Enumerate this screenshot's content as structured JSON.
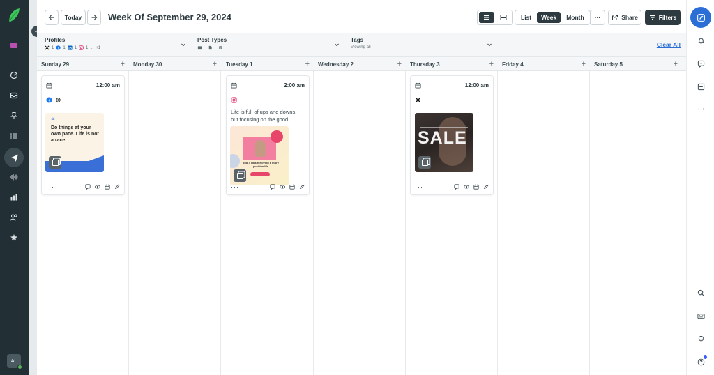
{
  "user": {
    "initials": "AL"
  },
  "header": {
    "today_label": "Today",
    "week_title": "Week Of September 29, 2024",
    "view_list": "List",
    "view_week": "Week",
    "view_month": "Month",
    "more_label": "···",
    "share_label": "Share",
    "filters_label": "Filters"
  },
  "filterbar": {
    "profiles_label": "Profiles",
    "profiles_counts": {
      "x": "1",
      "facebook": "1",
      "linkedin": "1",
      "instagram": "1",
      "extra": "+1"
    },
    "extra_dots": "...",
    "post_types_label": "Post Types",
    "tags_label": "Tags",
    "tags_sub": "Viewing all",
    "clear_all": "Clear All"
  },
  "days": [
    {
      "label": "Sunday 29"
    },
    {
      "label": "Monday 30"
    },
    {
      "label": "Tuesday 1"
    },
    {
      "label": "Wednesday 2"
    },
    {
      "label": "Thursday 3"
    },
    {
      "label": "Friday 4"
    },
    {
      "label": "Saturday 5"
    }
  ],
  "add_symbol": "+",
  "posts": [
    {
      "time": "12:00 am",
      "networks": [
        "facebook",
        "threads"
      ],
      "image_text": "Do things at your own pace. Life is not a race.",
      "quote_mark": "“"
    },
    {
      "time": "2:00 am",
      "networks": [
        "instagram"
      ],
      "caption": "Life is full of ups and downs, but focusing on the good...",
      "image_text": "Top 7 Tips for living a more positive life"
    },
    {
      "time": "12:00 am",
      "networks": [
        "x"
      ],
      "image_text": "SALE"
    }
  ],
  "more_dots": "···",
  "colors": {
    "rail": "#223036",
    "accent": "#2b6fd6",
    "dark": "#2d3a3f",
    "facebook": "#1877f2",
    "instagram": "#e1306c",
    "linkedin": "#0a66c2",
    "logo": "#3cc55a"
  }
}
